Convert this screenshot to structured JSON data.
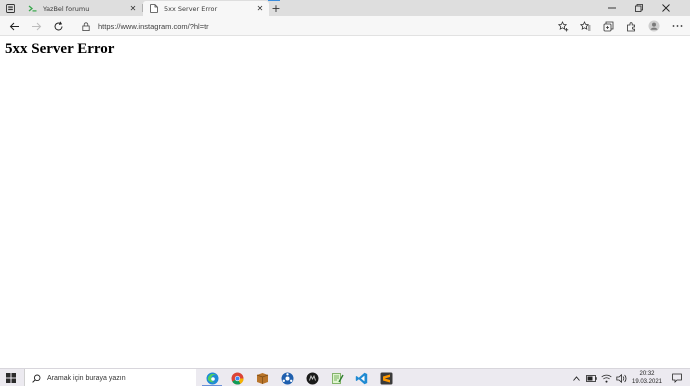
{
  "browser": {
    "tabs": [
      {
        "title": "YazBel forumu",
        "active": false,
        "favicon": "yazbel-terminal-icon"
      },
      {
        "title": "5xx Server Error",
        "active": true,
        "favicon": "document-icon"
      }
    ],
    "url": "https://www.instagram.com/?hl=tr"
  },
  "page": {
    "heading": "5xx Server Error"
  },
  "taskbar": {
    "search_placeholder": "Aramak için buraya yazın",
    "apps": [
      "edge-icon",
      "chrome-icon",
      "archive-icon",
      "network-icon",
      "dark-app-icon",
      "notepad-icon",
      "vscode-icon",
      "sublime-icon"
    ],
    "clock": {
      "time": "20:32",
      "date": "19.03.2021"
    }
  },
  "colors": {
    "tabstrip": "#dedede",
    "toolbar": "#f7f7f7",
    "taskbar": "#eceaf0",
    "accent": "#3b8cdc"
  }
}
